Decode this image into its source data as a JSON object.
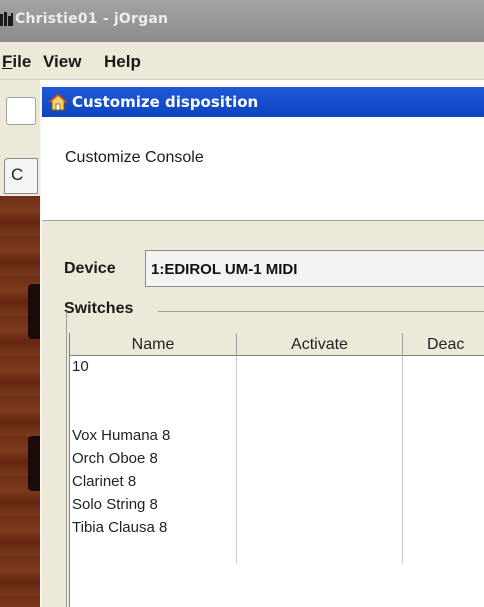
{
  "app": {
    "title": "Christie01 - jOrgan",
    "icon": "organ-pipes-icon"
  },
  "menubar": {
    "items": [
      {
        "label": "File",
        "mnemonic": "F"
      },
      {
        "label": "View"
      },
      {
        "label": "Help"
      }
    ]
  },
  "background": {
    "tab_label": "C"
  },
  "dialog": {
    "icon": "home-icon",
    "title": "Customize disposition",
    "header_text": "Customize Console",
    "device": {
      "label": "Device",
      "value": "1:EDIROL UM-1 MIDI"
    },
    "switches": {
      "label": "Switches",
      "columns": [
        "Name",
        "Activate",
        "Deac"
      ],
      "rows": [
        [
          "10",
          "",
          ""
        ],
        [
          "",
          "",
          ""
        ],
        [
          "",
          "",
          ""
        ],
        [
          "Vox Humana 8",
          "",
          ""
        ],
        [
          "Orch Oboe 8",
          "",
          ""
        ],
        [
          "Clarinet 8",
          "",
          ""
        ],
        [
          "Solo String 8",
          "",
          ""
        ],
        [
          "Tibia Clausa 8",
          "",
          ""
        ],
        [
          "",
          "",
          ""
        ]
      ]
    }
  }
}
